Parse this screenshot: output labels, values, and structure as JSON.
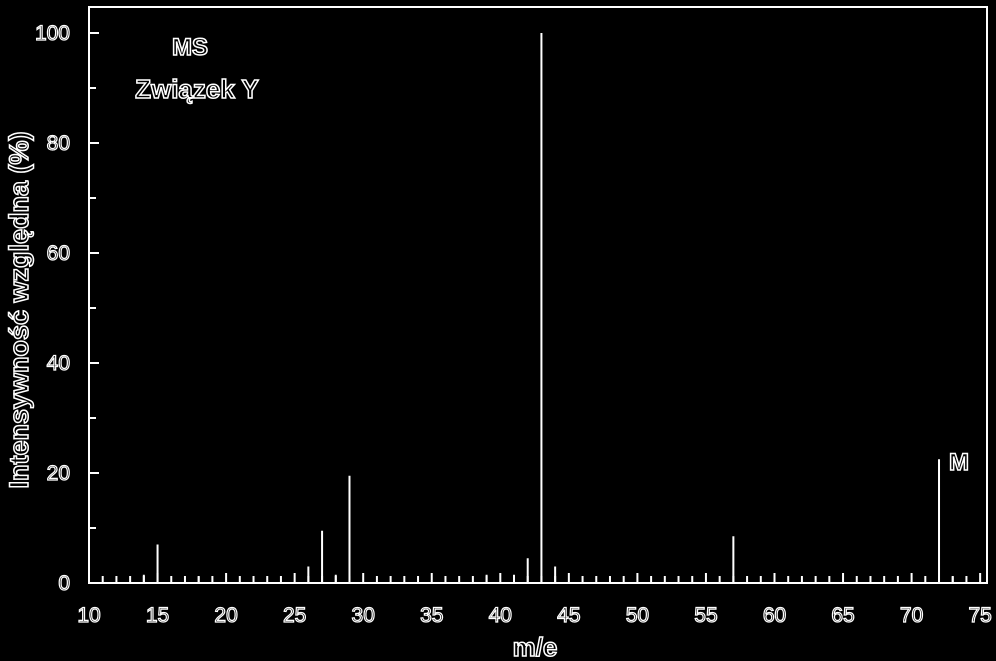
{
  "chart_data": {
    "type": "bar",
    "title": "MS",
    "subtitle": "Związek Y",
    "xlabel": "m/e",
    "ylabel": "Intensywność względna (%)",
    "xlim": [
      10,
      75.5
    ],
    "ylim": [
      0,
      100
    ],
    "grid": false,
    "x_ticks": [
      "10",
      "15",
      "20",
      "25",
      "30",
      "35",
      "40",
      "45",
      "50",
      "55",
      "60",
      "65",
      "70",
      "75"
    ],
    "y_ticks": [
      "0",
      "20",
      "40",
      "60",
      "80",
      "100"
    ],
    "peaks": [
      {
        "x": 14,
        "y": 1.5
      },
      {
        "x": 15,
        "y": 7
      },
      {
        "x": 18,
        "y": 1.2
      },
      {
        "x": 26,
        "y": 3
      },
      {
        "x": 27,
        "y": 9.5
      },
      {
        "x": 28,
        "y": 1.5
      },
      {
        "x": 29,
        "y": 19.5
      },
      {
        "x": 39,
        "y": 1.5
      },
      {
        "x": 41,
        "y": 1.5
      },
      {
        "x": 42,
        "y": 4.5
      },
      {
        "x": 43,
        "y": 100
      },
      {
        "x": 44,
        "y": 3
      },
      {
        "x": 57,
        "y": 8.5
      },
      {
        "x": 72,
        "y": 22.5
      },
      {
        "x": 73,
        "y": 1.2
      }
    ],
    "annotations": [
      {
        "label": "M",
        "x": 72
      }
    ],
    "colors": {
      "background": "#000000",
      "foreground": "#ffffff"
    }
  }
}
